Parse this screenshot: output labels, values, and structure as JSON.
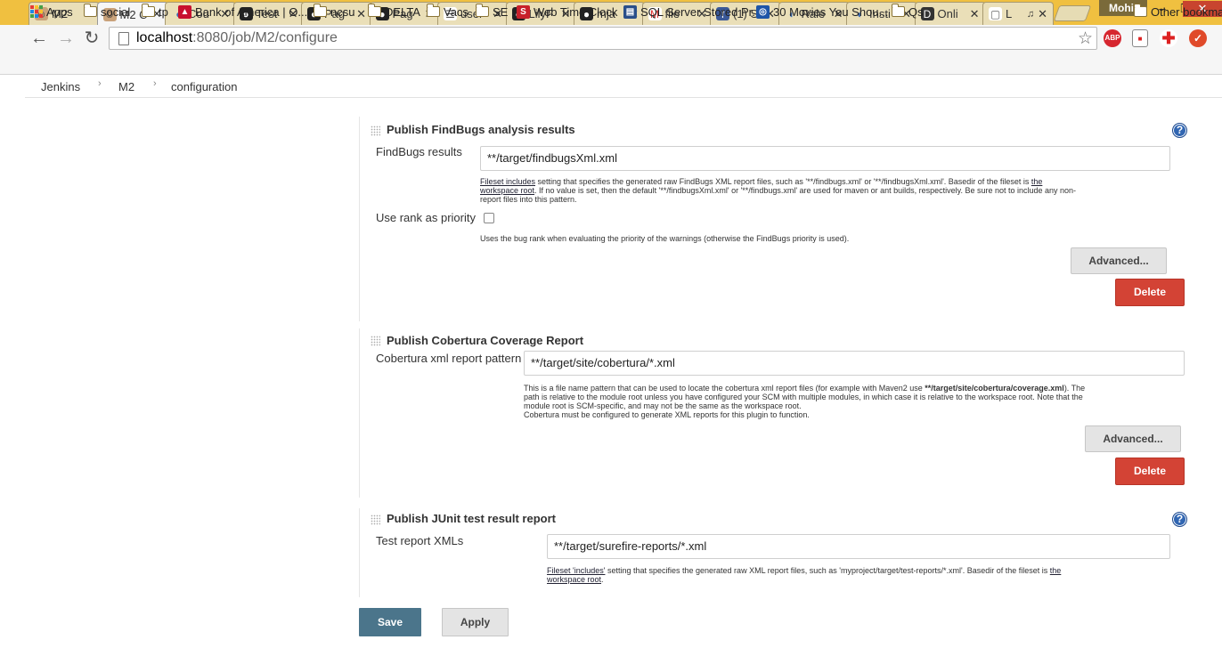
{
  "browser": {
    "tabs": [
      {
        "title": "M2",
        "icon": "jenkins-icon"
      },
      {
        "title": "M2 C",
        "icon": "jenkins-icon",
        "active": true
      },
      {
        "title": "Cou",
        "icon": "loading-icon"
      },
      {
        "title": "Test",
        "icon": "github-icon"
      },
      {
        "title": "Pag",
        "icon": "github-icon"
      },
      {
        "title": "Pag",
        "icon": "github-icon"
      },
      {
        "title": "user",
        "icon": "stackoverflow-icon"
      },
      {
        "title": "LilyF",
        "icon": "github-icon"
      },
      {
        "title": "mja",
        "icon": "github-icon"
      },
      {
        "title": "file",
        "icon": "gmail-icon"
      },
      {
        "title": "(1) S",
        "icon": "facebook-icon"
      },
      {
        "title": "Rale",
        "icon": "loading-icon"
      },
      {
        "title": "Insti",
        "icon": "loading-icon"
      },
      {
        "title": "Onli",
        "icon": "d-icon"
      },
      {
        "title": "L",
        "icon": "page-icon",
        "audio": true
      }
    ],
    "user": "Mohit",
    "url_host": "localhost",
    "url_rest": ":8080/job/M2/configure",
    "bookmarks": [
      {
        "label": "Apps",
        "icon": "apps-icon"
      },
      {
        "label": "social",
        "icon": "folder-icon"
      },
      {
        "label": "tp",
        "icon": "folder-icon"
      },
      {
        "label": "Bank of America | O...",
        "icon": "bofa-icon"
      },
      {
        "label": "ncsu",
        "icon": "folder-icon"
      },
      {
        "label": "DELTA",
        "icon": "folder-icon"
      },
      {
        "label": "Vacs",
        "icon": "folder-icon"
      },
      {
        "label": "SE",
        "icon": "folder-icon"
      },
      {
        "label": "Web Time Clock",
        "icon": "s-icon"
      },
      {
        "label": "SQL Server Stored Pr...",
        "icon": "sql-icon"
      },
      {
        "label": "30 Movies You Shou...",
        "icon": "c-icon"
      },
      {
        "label": "Qs",
        "icon": "folder-icon"
      }
    ],
    "other_bookmarks": "Other bookma"
  },
  "breadcrumb": [
    "Jenkins",
    "M2",
    "configuration"
  ],
  "findbugs": {
    "title": "Publish FindBugs analysis results",
    "results_label": "FindBugs results",
    "results_value": "**/target/findbugsXml.xml",
    "help_link1": "Fileset includes",
    "help_text1": " setting that specifies the generated raw FindBugs XML report files, such as '**/findbugs.xml' or '**/findbugsXml.xml'. Basedir of the fileset is ",
    "help_link2a": "the",
    "help_link2b": "workspace root",
    "help_text2": ". If no value is set, then the default '**/findbugsXml.xml' or '**/findbugs.xml' are used for maven or ant builds, respectively. Be sure not to include any non-",
    "help_text3": "report files into this pattern.",
    "rank_label": "Use rank as priority",
    "rank_help": "Uses the bug rank when evaluating the priority of the warnings (otherwise the FindBugs priority is used).",
    "advanced": "Advanced...",
    "delete": "Delete"
  },
  "cobertura": {
    "title": "Publish Cobertura Coverage Report",
    "pattern_label": "Cobertura xml report pattern",
    "pattern_value": "**/target/site/cobertura/*.xml",
    "help1": "This is a file name pattern that can be used to locate the cobertura xml report files (for example with Maven2 use ",
    "help1_bold": "**/target/site/cobertura/coverage.xml",
    "help1_end": "). The",
    "help2": "path is relative to the module root unless you have configured your SCM with multiple modules, in which case it is relative to the workspace root. Note that the",
    "help3": "module root is SCM-specific, and may not be the same as the workspace root.",
    "help4": "Cobertura must be configured to generate XML reports for this plugin to function.",
    "advanced": "Advanced...",
    "delete": "Delete"
  },
  "junit": {
    "title": "Publish JUnit test result report",
    "xmls_label": "Test report XMLs",
    "xmls_value": "**/target/surefire-reports/*.xml",
    "help_link1": "Fileset 'includes'",
    "help_text1": " setting that specifies the generated raw XML report files, such as 'myproject/target/test-reports/*.xml'. Basedir of the fileset is ",
    "help_link2a": "the",
    "help_link2b": "workspace root",
    "help_text2": "."
  },
  "actions": {
    "save": "Save",
    "apply": "Apply"
  }
}
